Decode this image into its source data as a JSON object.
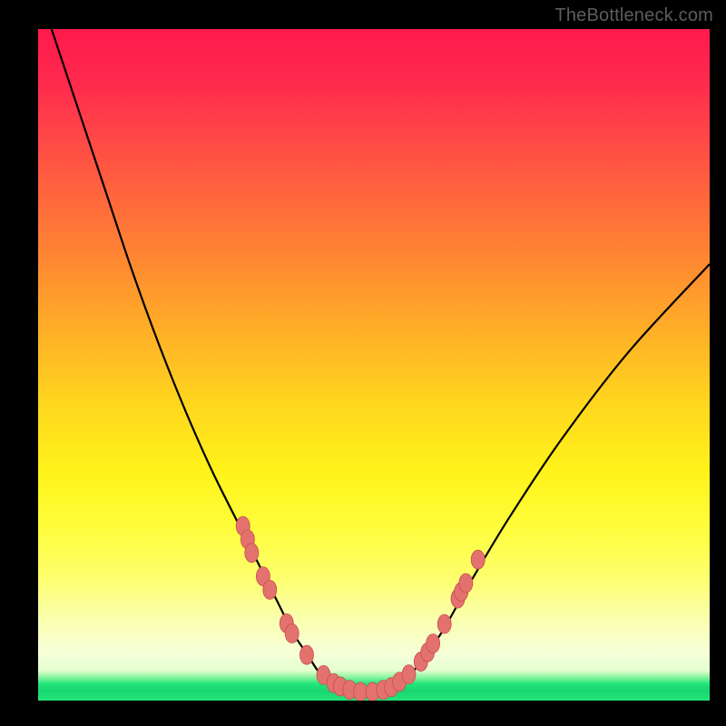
{
  "watermark": "TheBottleneck.com",
  "chart_data": {
    "type": "line",
    "title": "",
    "xlabel": "",
    "ylabel": "",
    "xlim": [
      0,
      100
    ],
    "ylim": [
      0,
      100
    ],
    "series": [
      {
        "name": "curve",
        "x": [
          2,
          6,
          10,
          14,
          18,
          22,
          26,
          30,
          33,
          36,
          38,
          40,
          42,
          44,
          46,
          48,
          50,
          52,
          54,
          56,
          60,
          64,
          70,
          78,
          88,
          100
        ],
        "y": [
          100,
          88,
          76,
          64,
          53,
          43,
          34,
          26,
          20,
          14,
          10,
          7,
          4,
          2.5,
          1.6,
          1.2,
          1.2,
          1.6,
          2.6,
          4.5,
          10,
          17,
          27,
          39,
          52,
          65
        ]
      }
    ],
    "markers": [
      {
        "x": 30.5,
        "y": 26
      },
      {
        "x": 31.2,
        "y": 24
      },
      {
        "x": 31.8,
        "y": 22
      },
      {
        "x": 33.5,
        "y": 18.5
      },
      {
        "x": 34.5,
        "y": 16.5
      },
      {
        "x": 37.0,
        "y": 11.5
      },
      {
        "x": 37.8,
        "y": 10
      },
      {
        "x": 40.0,
        "y": 6.8
      },
      {
        "x": 42.5,
        "y": 3.8
      },
      {
        "x": 44.0,
        "y": 2.6
      },
      {
        "x": 45.0,
        "y": 2.1
      },
      {
        "x": 46.4,
        "y": 1.6
      },
      {
        "x": 48.0,
        "y": 1.3
      },
      {
        "x": 49.8,
        "y": 1.3
      },
      {
        "x": 51.4,
        "y": 1.6
      },
      {
        "x": 52.6,
        "y": 2.0
      },
      {
        "x": 53.8,
        "y": 2.8
      },
      {
        "x": 55.2,
        "y": 3.9
      },
      {
        "x": 57.0,
        "y": 5.8
      },
      {
        "x": 58.0,
        "y": 7.2
      },
      {
        "x": 58.8,
        "y": 8.5
      },
      {
        "x": 60.5,
        "y": 11.4
      },
      {
        "x": 62.5,
        "y": 15.2
      },
      {
        "x": 63.0,
        "y": 16.2
      },
      {
        "x": 63.7,
        "y": 17.5
      },
      {
        "x": 65.5,
        "y": 21.0
      }
    ],
    "colors": {
      "curve": "#000000",
      "marker_fill": "#e3726f",
      "marker_stroke": "#c94e4b"
    }
  }
}
